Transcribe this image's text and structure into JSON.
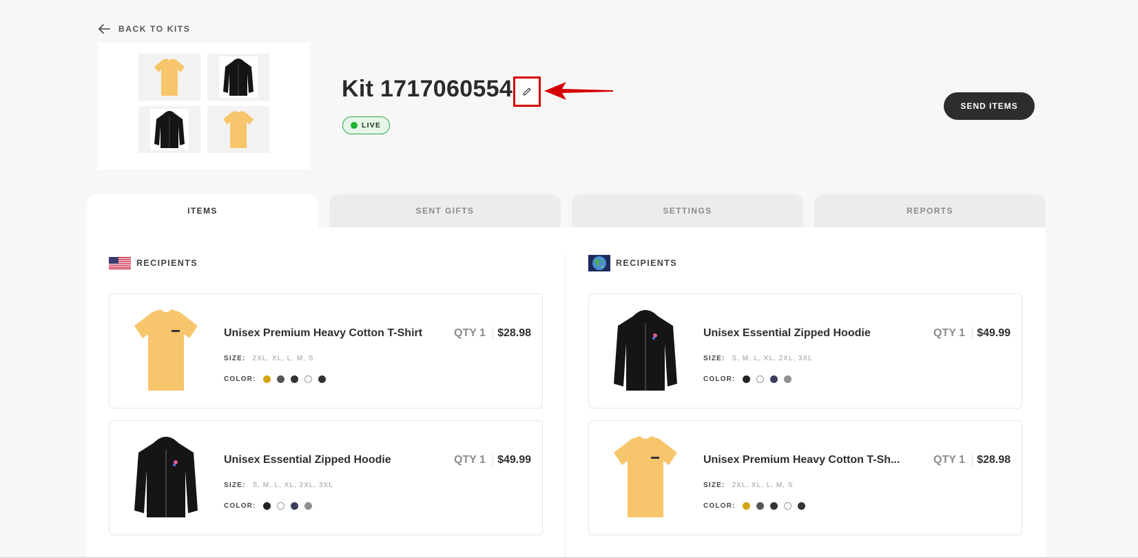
{
  "nav": {
    "back_label": "BACK TO KITS"
  },
  "kit": {
    "title": "Kit 1717060554",
    "status": "LIVE",
    "send_label": "SEND ITEMS"
  },
  "tabs": [
    {
      "label": "ITEMS"
    },
    {
      "label": "SENT GIFTS"
    },
    {
      "label": "SETTINGS"
    },
    {
      "label": "REPORTS"
    }
  ],
  "us_section": {
    "label": "RECIPIENTS",
    "items": [
      {
        "name": "Unisex Premium Heavy Cotton T-Shirt",
        "qty": "QTY 1",
        "price": "$28.98",
        "size_label": "SIZE:",
        "sizes": "2XL, XL, L, M, S",
        "color_label": "COLOR:",
        "colors": [
          "#d4a514",
          "#555555",
          "#333333",
          "#ffffff",
          "#333333"
        ]
      },
      {
        "name": "Unisex Essential Zipped Hoodie",
        "qty": "QTY 1",
        "price": "$49.99",
        "size_label": "SIZE:",
        "sizes": "S, M, L, XL, 2XL, 3XL",
        "color_label": "COLOR:",
        "colors": [
          "#222222",
          "#ffffff",
          "#3d3d5c",
          "#8f8f8f"
        ]
      }
    ]
  },
  "intl_section": {
    "label": "RECIPIENTS",
    "items": [
      {
        "name": "Unisex Essential Zipped Hoodie",
        "qty": "QTY 1",
        "price": "$49.99",
        "size_label": "SIZE:",
        "sizes": "S, M, L, XL, 2XL, 3XL",
        "color_label": "COLOR:",
        "colors": [
          "#222222",
          "#ffffff",
          "#3d3d5c",
          "#8f8f8f"
        ]
      },
      {
        "name": "Unisex Premium Heavy Cotton T-Sh...",
        "qty": "QTY 1",
        "price": "$28.98",
        "size_label": "SIZE:",
        "sizes": "2XL, XL, L, M, S",
        "color_label": "COLOR:",
        "colors": [
          "#d4a514",
          "#555555",
          "#333333",
          "#ffffff",
          "#333333"
        ]
      }
    ]
  },
  "icons": {
    "back": "arrow-left-icon",
    "edit": "pencil-icon",
    "us_flag": "us-flag-icon",
    "globe": "globe-icon"
  },
  "colors": {
    "accent_dark": "#2d2d2d",
    "live_green": "#1db32e",
    "annotation_red": "#d40000"
  }
}
